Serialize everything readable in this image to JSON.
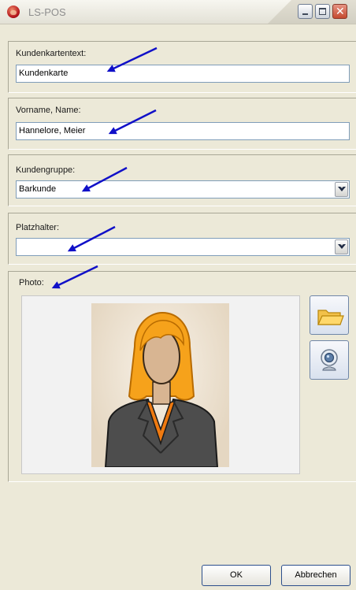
{
  "window": {
    "title": "LS-POS"
  },
  "fields": {
    "kundenkartentext": {
      "label": "Kundenkartentext:",
      "value": "Kundenkarte"
    },
    "vorname_name": {
      "label": "Vorname, Name:",
      "value": "Hannelore, Meier"
    },
    "kundengruppe": {
      "label": "Kundengruppe:",
      "value": "Barkunde"
    },
    "platzhalter": {
      "label": "Platzhalter:",
      "value": ""
    }
  },
  "photo": {
    "label": "Photo:"
  },
  "buttons": {
    "ok": "OK",
    "cancel": "Abbrechen"
  },
  "colors": {
    "annotation_arrow": "#1010c8",
    "portrait_hair": "#f6a21b",
    "portrait_jacket": "#4a4a4a",
    "portrait_shirt": "#f07a10"
  }
}
